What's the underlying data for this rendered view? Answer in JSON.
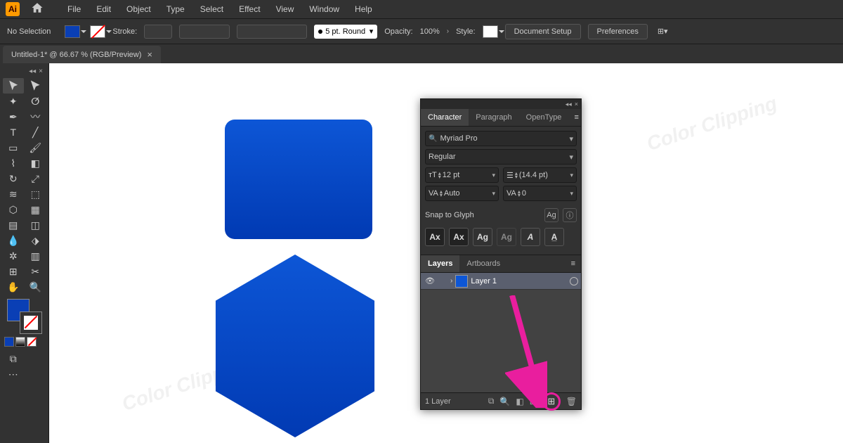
{
  "app": {
    "icon_label": "Ai"
  },
  "menu": {
    "items": [
      "File",
      "Edit",
      "Object",
      "Type",
      "Select",
      "Effect",
      "View",
      "Window",
      "Help"
    ]
  },
  "control_bar": {
    "selection_label": "No Selection",
    "stroke_label": "Stroke:",
    "brush_label": "5 pt. Round",
    "opacity_label": "Opacity:",
    "opacity_value": "100%",
    "style_label": "Style:",
    "doc_setup_btn": "Document Setup",
    "prefs_btn": "Preferences"
  },
  "tab": {
    "title": "Untitled-1* @ 66.67 % (RGB/Preview)"
  },
  "panel": {
    "tabs": [
      "Character",
      "Paragraph",
      "OpenType"
    ],
    "font_family": "Myriad Pro",
    "font_style": "Regular",
    "font_size": "12 pt",
    "leading": "(14.4 pt)",
    "kerning": "Auto",
    "tracking": "0",
    "snap_label": "Snap to Glyph",
    "layers_tabs": [
      "Layers",
      "Artboards"
    ],
    "layer_name": "Layer 1",
    "layer_count": "1 Layer"
  },
  "watermark": "Color Clipping",
  "colors": {
    "accent": "#0d56d6",
    "highlight": "#e91e9e"
  }
}
